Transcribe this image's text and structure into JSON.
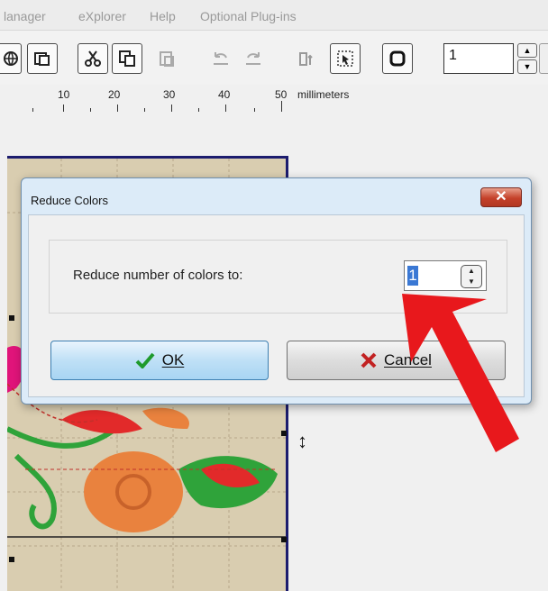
{
  "menubar": {
    "items": [
      "lanager",
      "eXplorer",
      "Help",
      "Optional Plug-ins"
    ]
  },
  "toolbar": {
    "buttons": [
      "globe-icon",
      "copy-icon",
      "cut-icon",
      "paste-icon",
      "paste-special-icon",
      "undo-icon",
      "redo-icon",
      "size-icon",
      "select-icon",
      "stop-icon"
    ],
    "number_value": "1"
  },
  "ruler": {
    "labels": [
      "10",
      "20",
      "30",
      "40",
      "50"
    ],
    "unit": "millimeters"
  },
  "dialog": {
    "title": "Reduce Colors",
    "close_glyph": "✕",
    "label": "Reduce number of colors to:",
    "value": "1",
    "ok_label": "OK",
    "cancel_label": "Cancel"
  },
  "colors": {
    "dialog_bg": "#dcebf8",
    "ok_button": "#bfe0f6",
    "close_red": "#c4412a",
    "arrow_red": "#e8181c",
    "canvas_bg": "#d9cdb0"
  }
}
